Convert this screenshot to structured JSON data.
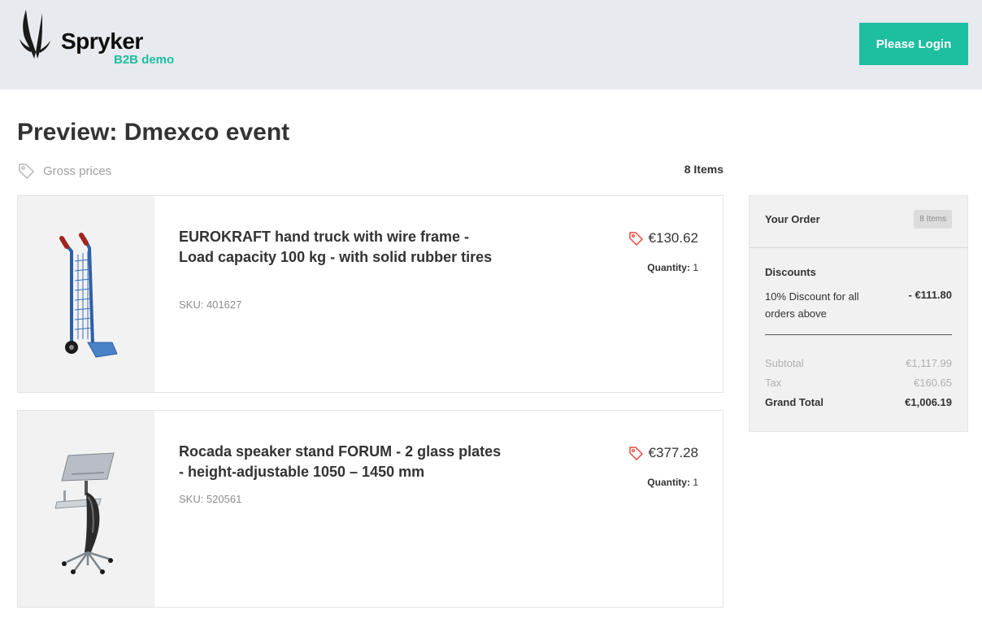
{
  "header": {
    "logo_name": "Spryker",
    "logo_sub": "B2B demo",
    "login_label": "Please Login"
  },
  "page": {
    "title": "Preview: Dmexco event",
    "price_mode": "Gross prices",
    "items_count": "8 Items"
  },
  "items": [
    {
      "name": "EUROKRAFT hand truck with wire frame - Load capacity 100 kg - with solid rubber tires",
      "sku": "SKU: 401627",
      "price": "€130.62",
      "quantity_label": "Quantity:",
      "quantity": "1"
    },
    {
      "name": "Rocada speaker stand FORUM - 2 glass plates - height-adjustable 1050 – 1450 mm",
      "sku": "SKU: 520561",
      "price": "€377.28",
      "quantity_label": "Quantity:",
      "quantity": "1"
    }
  ],
  "summary": {
    "title": "Your Order",
    "badge": "8 Items",
    "discounts_title": "Discounts",
    "discount_label": "10% Discount for all orders above",
    "discount_amount": "- €111.80",
    "subtotal_label": "Subtotal",
    "subtotal_value": "€1,117.99",
    "tax_label": "Tax",
    "tax_value": "€160.65",
    "grand_total_label": "Grand Total",
    "grand_total_value": "€1,006.19"
  },
  "colors": {
    "accent": "#1ebea0",
    "header_bg": "#e7eaee",
    "tag_icon": "#e8483d"
  },
  "icons": {
    "logo": "antelope-logo-icon",
    "price_mode": "price-tag-icon",
    "item_price": "price-tag-icon"
  }
}
